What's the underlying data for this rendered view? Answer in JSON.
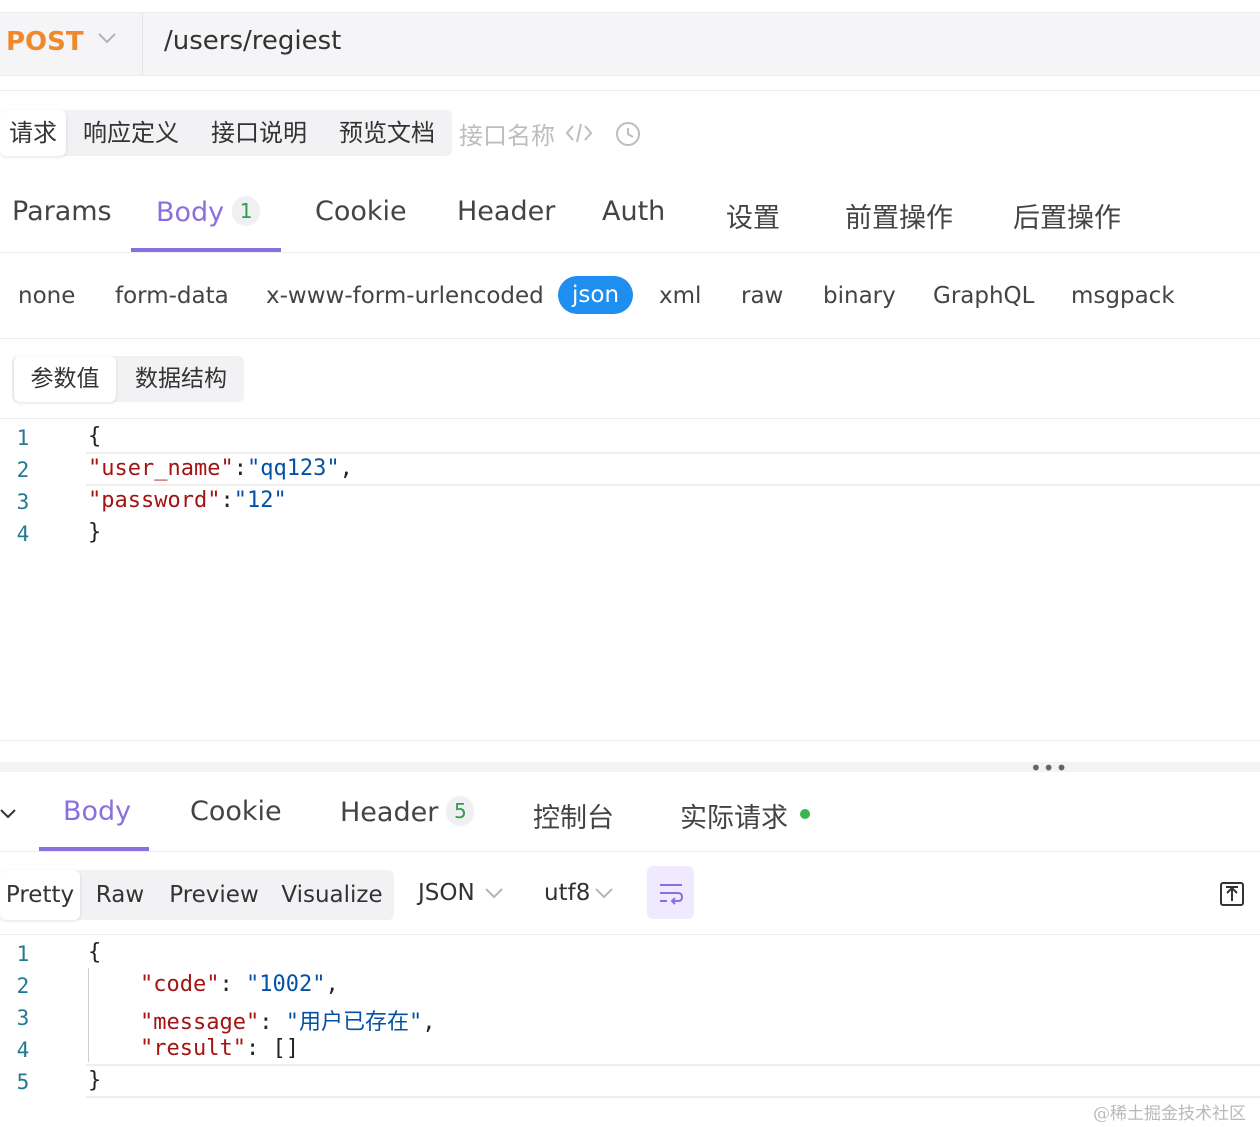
{
  "request_bar": {
    "method": "POST",
    "url": "/users/regiest"
  },
  "doc_tabs": [
    "请求",
    "响应定义",
    "接口说明",
    "预览文档"
  ],
  "iface_name_placeholder": "接口名称",
  "request_tabs": [
    {
      "label": "Params"
    },
    {
      "label": "Body",
      "badge": "1"
    },
    {
      "label": "Cookie"
    },
    {
      "label": "Header"
    },
    {
      "label": "Auth"
    },
    {
      "label": "设置"
    },
    {
      "label": "前置操作"
    },
    {
      "label": "后置操作"
    }
  ],
  "body_types": [
    "none",
    "form-data",
    "x-www-form-urlencoded",
    "json",
    "xml",
    "raw",
    "binary",
    "GraphQL",
    "msgpack"
  ],
  "param_tabs": [
    "参数值",
    "数据结构"
  ],
  "request_editor": {
    "line_numbers": [
      "1",
      "2",
      "3",
      "4"
    ],
    "open": "{",
    "k1": "\"user_name\"",
    "sep1": ":",
    "v1": "\"qq123\"",
    "c1": ",",
    "k2": "\"password\"",
    "sep2": ":",
    "v2": "\"12\"",
    "close": "}"
  },
  "splitter_dots": "•••",
  "response_tabs": [
    {
      "label": "Body"
    },
    {
      "label": "Cookie"
    },
    {
      "label": "Header",
      "badge": "5"
    },
    {
      "label": "控制台"
    },
    {
      "label": "实际请求"
    }
  ],
  "format_tabs": [
    "Pretty",
    "Raw",
    "Preview",
    "Visualize"
  ],
  "format_dropdown": "JSON",
  "encoding_dropdown": "utf8",
  "response_editor": {
    "line_numbers": [
      "1",
      "2",
      "3",
      "4",
      "5"
    ],
    "open": "{",
    "k1": "\"code\"",
    "sep1": ": ",
    "v1": "\"1002\"",
    "c1": ",",
    "k2": "\"message\"",
    "sep2": ": ",
    "v2": "\"用户已存在\"",
    "c2": ",",
    "k3": "\"result\"",
    "sep3": ": ",
    "v3": "[]",
    "close": "}"
  },
  "watermark": "@稀土掘金技术社区",
  "colors": {
    "method": "#f0892b",
    "accent": "#8a6fdf",
    "json_active": "#1e8ef0",
    "badge_green": "#2e9e4d"
  }
}
